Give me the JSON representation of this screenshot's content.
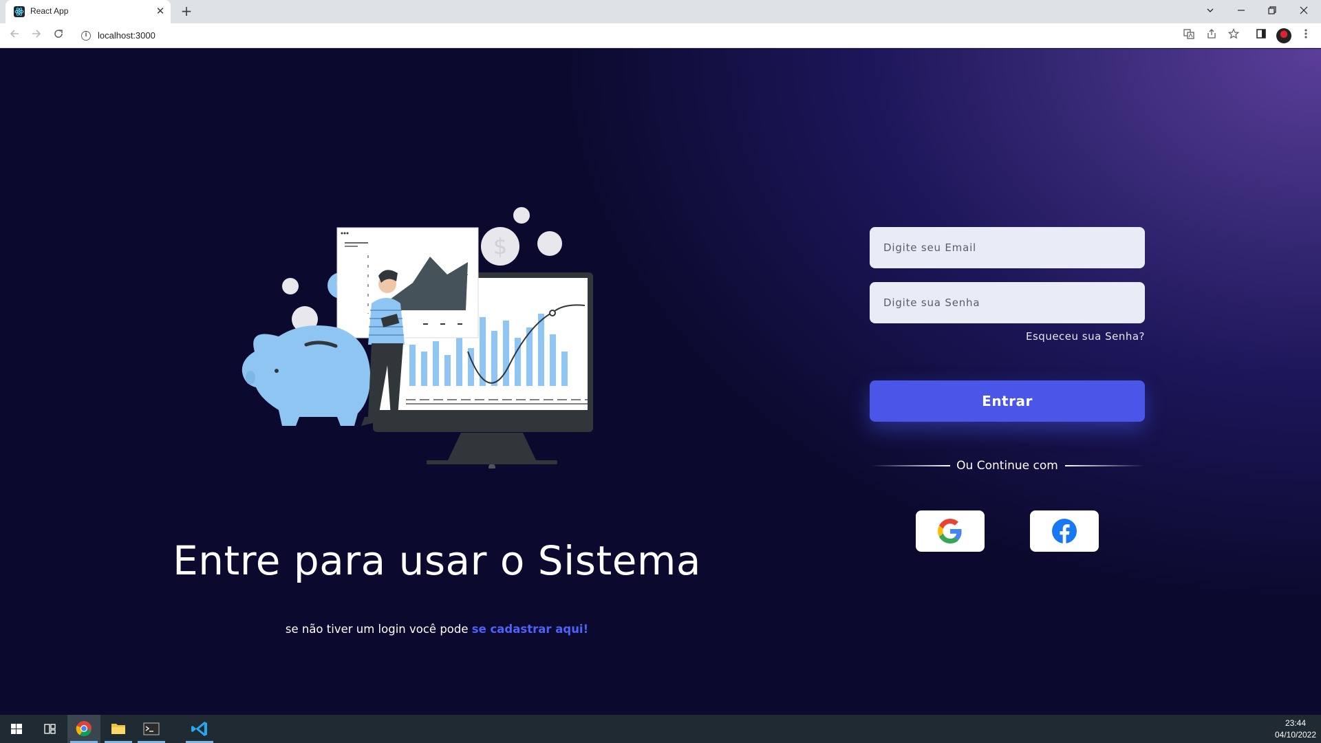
{
  "browser": {
    "tab_title": "React App",
    "tab_close": "✕",
    "new_tab": "+",
    "url": "localhost:3000",
    "icons": [
      "back-icon",
      "forward-icon",
      "reload-icon",
      "info-icon",
      "translate-icon",
      "share-icon",
      "bookmark-star-icon",
      "side-panel-icon",
      "profile-avatar",
      "menu-dots-icon"
    ],
    "window_controls": [
      "tab-search-icon",
      "minimize-icon",
      "restore-icon",
      "close-icon"
    ]
  },
  "page": {
    "headline": "Entre para usar o Sistema",
    "subline_prefix": "se não tiver um login você pode ",
    "subline_link": "se cadastrar aqui!",
    "link_color": "#4e62f5",
    "illustration": "piggy-bank-finance-illustration"
  },
  "login": {
    "email_placeholder": "Digite seu Email",
    "password_placeholder": "Digite sua Senha",
    "forgot_label": "Esqueceu sua Senha?",
    "submit_label": "Entrar",
    "submit_color": "#4a56e8",
    "divider_label": "Ou Continue com",
    "social": [
      {
        "icon": "google-icon"
      },
      {
        "icon": "facebook-icon"
      }
    ]
  },
  "taskbar": {
    "apps": [
      "windows-start-icon",
      "task-view-icon",
      "chrome-icon",
      "file-explorer-icon",
      "terminal-icon",
      "vscode-icon"
    ],
    "time": "23:44",
    "date": "04/10/2022"
  }
}
